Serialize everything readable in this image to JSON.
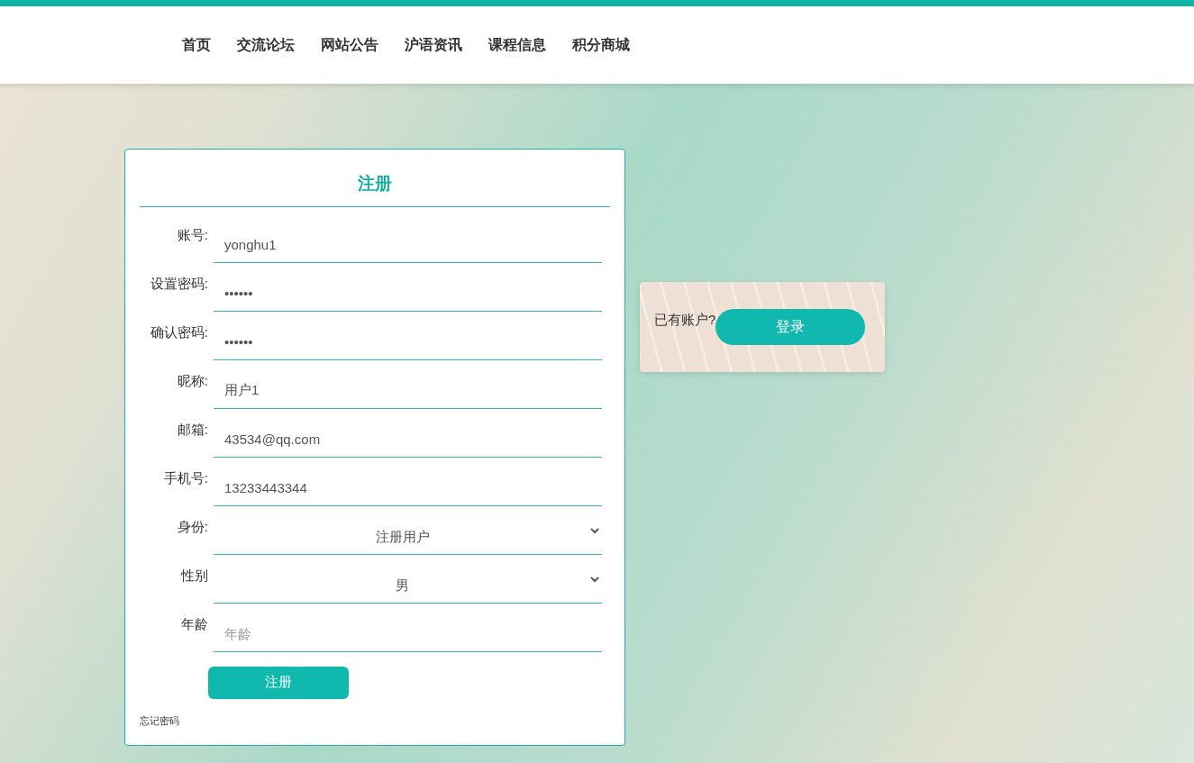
{
  "nav": {
    "items": [
      "首页",
      "交流论坛",
      "网站公告",
      "沪语资讯",
      "课程信息",
      "积分商城"
    ]
  },
  "register_form": {
    "title": "注册",
    "fields": [
      {
        "kind": "text",
        "label": "账号:",
        "value": "yonghu1"
      },
      {
        "kind": "text",
        "label": "设置密码:",
        "value": "••••••"
      },
      {
        "kind": "text",
        "label": "确认密码:",
        "value": "••••••"
      },
      {
        "kind": "text",
        "label": "昵称:",
        "value": "用户1"
      },
      {
        "kind": "text",
        "label": "邮箱:",
        "value": "43534@qq.com"
      },
      {
        "kind": "text",
        "label": "手机号:",
        "value": "13233443344"
      },
      {
        "kind": "select",
        "label": "身份:",
        "value": "注册用户"
      },
      {
        "kind": "select",
        "label": "性别",
        "value": "男"
      },
      {
        "kind": "text",
        "label": "年龄",
        "placeholder": "年龄"
      }
    ],
    "submit": "注册",
    "forgot_link": "忘记密码"
  },
  "login_panel": {
    "prompt": "已有账户?",
    "button": "登录"
  }
}
